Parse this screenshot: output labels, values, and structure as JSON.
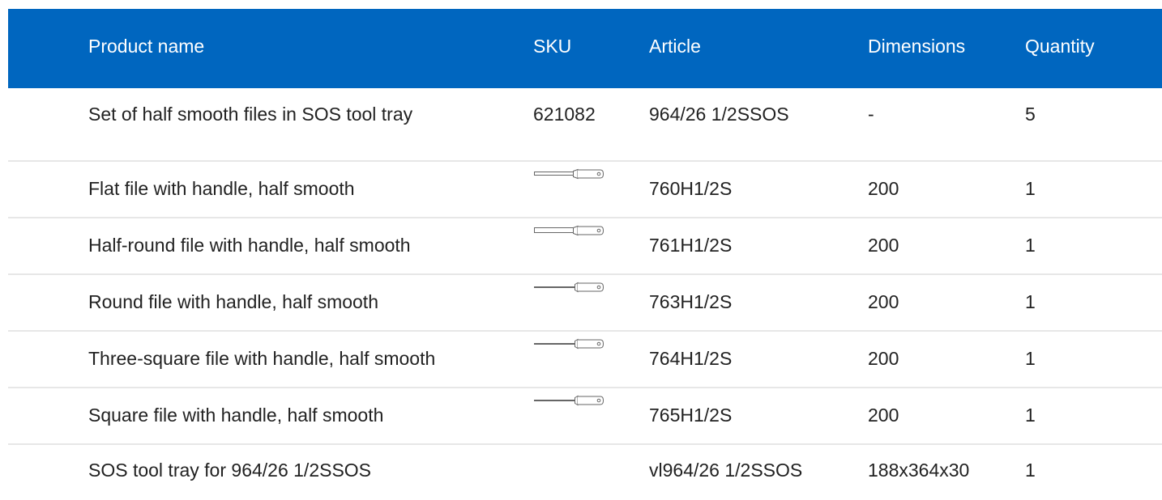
{
  "table": {
    "headers": {
      "product_name": "Product name",
      "sku": "SKU",
      "article": "Article",
      "dimensions": "Dimensions",
      "quantity": "Quantity"
    },
    "rows": [
      {
        "name": "Set of half smooth files in SOS tool tray",
        "sku": "621082",
        "article": "964/26 1/2SSOS",
        "dimensions": "-",
        "quantity": "5"
      },
      {
        "name": "Flat file with handle, half smooth",
        "image_icon": "flat-file-icon",
        "article": "760H1/2S",
        "dimensions": "200",
        "quantity": "1"
      },
      {
        "name": "Half-round file with handle, half smooth",
        "image_icon": "half-round-file-icon",
        "article": "761H1/2S",
        "dimensions": "200",
        "quantity": "1"
      },
      {
        "name": "Round file with handle, half smooth",
        "image_icon": "round-file-icon",
        "article": "763H1/2S",
        "dimensions": "200",
        "quantity": "1"
      },
      {
        "name": "Three-square file with handle, half smooth",
        "image_icon": "three-square-file-icon",
        "article": "764H1/2S",
        "dimensions": "200",
        "quantity": "1"
      },
      {
        "name": "Square file with handle, half smooth",
        "image_icon": "square-file-icon",
        "article": "765H1/2S",
        "dimensions": "200",
        "quantity": "1"
      },
      {
        "name": "SOS tool tray for 964/26 1/2SSOS",
        "article": "vl964/26 1/2SSOS",
        "dimensions": "188x364x30",
        "quantity": "1"
      }
    ]
  },
  "colors": {
    "header_bg": "#0066bf",
    "header_text": "#ffffff",
    "row_divider": "#e7e7e7",
    "body_text": "#222222"
  }
}
